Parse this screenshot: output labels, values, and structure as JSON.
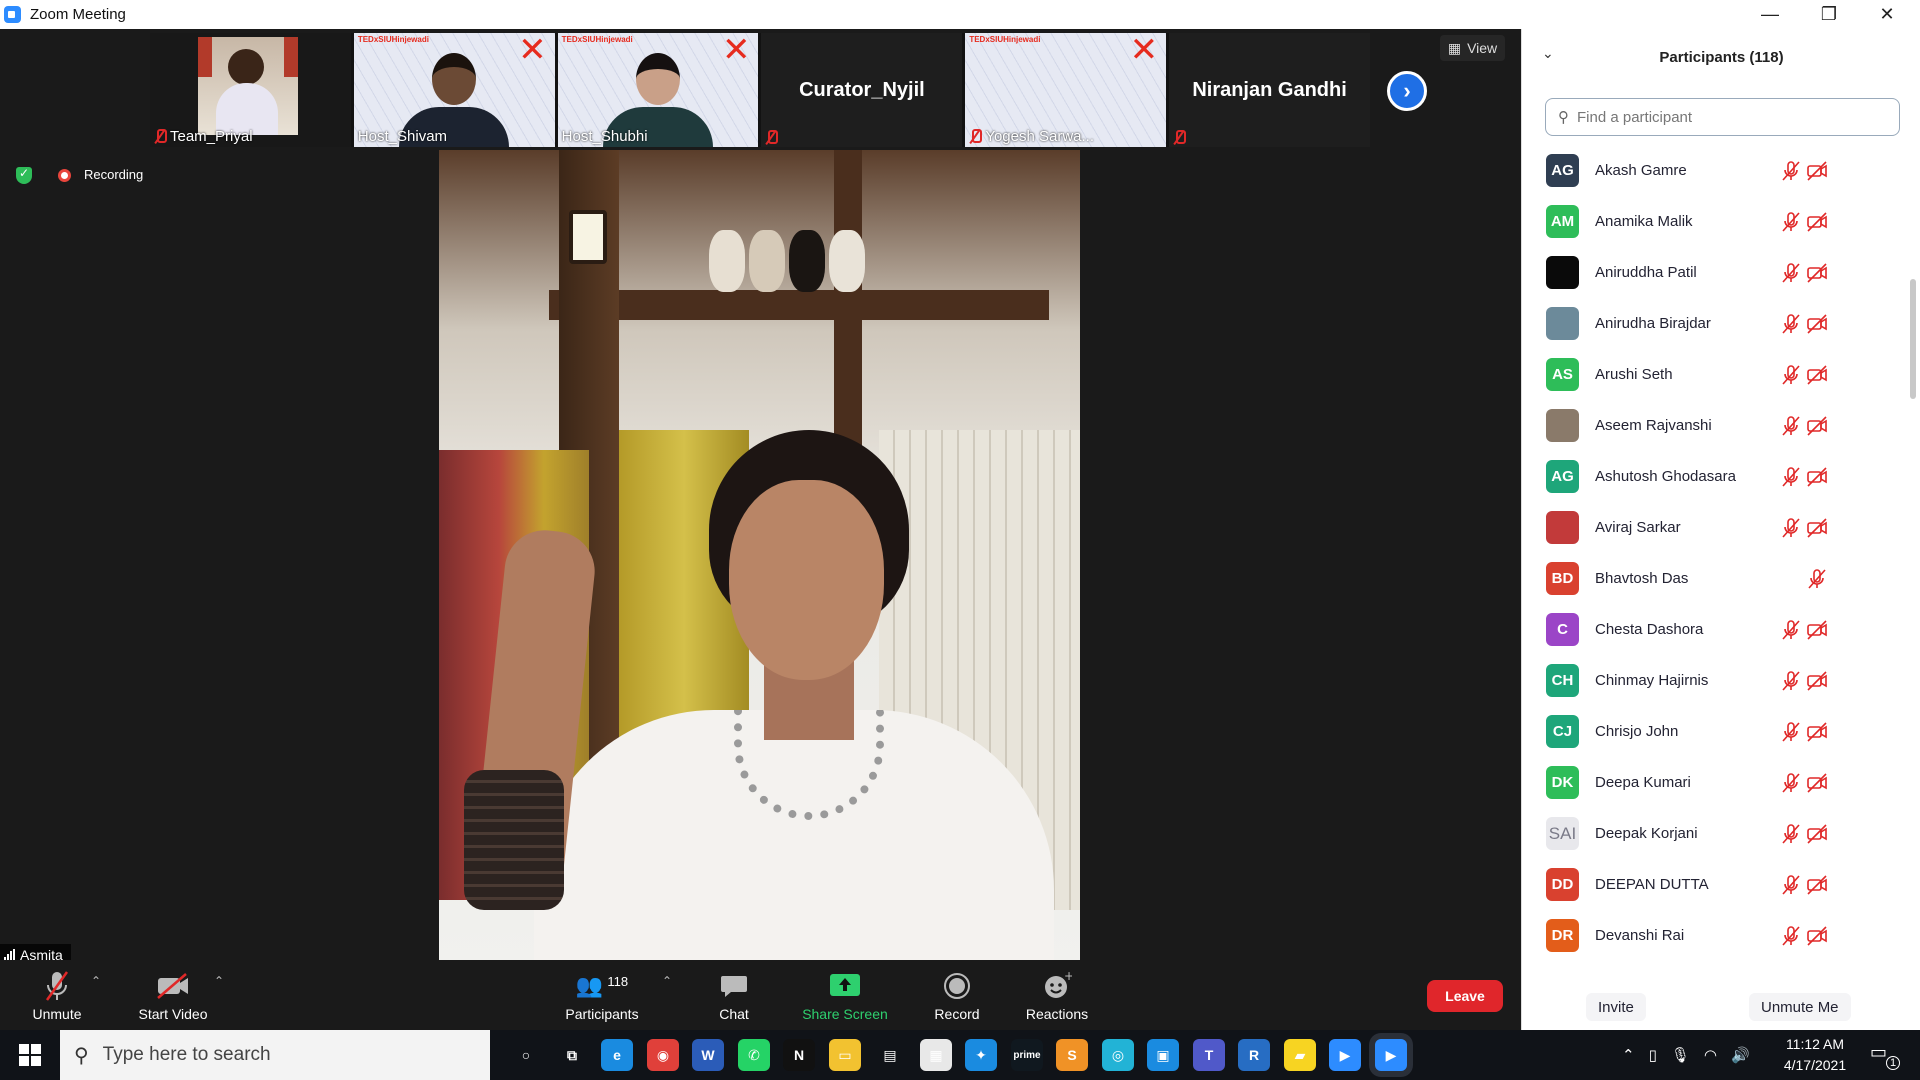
{
  "window": {
    "title": "Zoom Meeting",
    "minimize": "—",
    "restore": "❐",
    "close": "✕"
  },
  "thumbnails": [
    {
      "name": "Team_Priyal",
      "muted": true
    },
    {
      "name": "Host_Shivam",
      "muted": false
    },
    {
      "name": "Host_Shubhi",
      "muted": false
    },
    {
      "name": "Curator_Nyjil",
      "muted": true
    },
    {
      "name": "Yogesh Sarwa...",
      "muted": true
    },
    {
      "name": "Niranjan Gandhi",
      "muted": true
    }
  ],
  "tedx_label": "TEDxSIUHinjewadi",
  "view_label": "View",
  "recording_label": "Recording",
  "self_name": "Asmita",
  "toolbar": {
    "unmute": "Unmute",
    "start_video": "Start Video",
    "participants": "Participants",
    "participants_count": "118",
    "chat": "Chat",
    "share_screen": "Share Screen",
    "record": "Record",
    "reactions": "Reactions",
    "leave": "Leave"
  },
  "panel": {
    "title": "Participants (118)",
    "search_placeholder": "Find a participant",
    "invite": "Invite",
    "unmute_me": "Unmute Me"
  },
  "participants": [
    {
      "initials": "AG",
      "name": "Akash Gamre",
      "color": "#2f3e52",
      "video_icon": true
    },
    {
      "initials": "AM",
      "name": "Anamika Malik",
      "color": "#2ebd59",
      "video_icon": true
    },
    {
      "initials": "",
      "name": "Aniruddha Patil",
      "color": "#0a0a0a",
      "video_icon": true
    },
    {
      "initials": "",
      "name": "Anirudha Birajdar",
      "color": "#6c8a9a",
      "video_icon": true
    },
    {
      "initials": "AS",
      "name": "Arushi Seth",
      "color": "#2ebd59",
      "video_icon": true
    },
    {
      "initials": "",
      "name": "Aseem Rajvanshi",
      "color": "#8a7a6a",
      "video_icon": true
    },
    {
      "initials": "AG",
      "name": "Ashutosh Ghodasara",
      "color": "#1ea67a",
      "video_icon": true
    },
    {
      "initials": "",
      "name": "Aviraj Sarkar",
      "color": "#c23a3a",
      "video_icon": true
    },
    {
      "initials": "BD",
      "name": "Bhavtosh Das",
      "color": "#d9412f",
      "video_icon": false
    },
    {
      "initials": "C",
      "name": "Chesta Dashora",
      "color": "#9b45c7",
      "video_icon": true
    },
    {
      "initials": "CH",
      "name": "Chinmay Hajirnis",
      "color": "#1ea67a",
      "video_icon": true
    },
    {
      "initials": "CJ",
      "name": "Chrisjo John",
      "color": "#1ea67a",
      "video_icon": true
    },
    {
      "initials": "DK",
      "name": "Deepa Kumari",
      "color": "#2ebd59",
      "video_icon": true
    },
    {
      "initials": "SAI",
      "name": "Deepak Korjani",
      "color": "#e8e8ec",
      "video_icon": true
    },
    {
      "initials": "DD",
      "name": "DEEPAN DUTTA",
      "color": "#d9412f",
      "video_icon": true
    },
    {
      "initials": "DR",
      "name": "Devanshi Rai",
      "color": "#e35d1a",
      "video_icon": true
    }
  ],
  "taskbar": {
    "search_placeholder": "Type here to search",
    "time": "11:12 AM",
    "date": "4/17/2021",
    "notifications": "1",
    "apps": [
      {
        "icon": "cortana-icon",
        "glyph": "○",
        "color": "transparent"
      },
      {
        "icon": "task-view-icon",
        "glyph": "⧉",
        "color": "transparent"
      },
      {
        "icon": "edge-icon",
        "glyph": "e",
        "color": "#1a8be0"
      },
      {
        "icon": "chrome-icon",
        "glyph": "◉",
        "color": "#e0403a"
      },
      {
        "icon": "word-icon",
        "glyph": "W",
        "color": "#2b5cb8"
      },
      {
        "icon": "whatsapp-icon",
        "glyph": "✆",
        "color": "#25d366"
      },
      {
        "icon": "netflix-icon",
        "glyph": "N",
        "color": "#111111"
      },
      {
        "icon": "file-explorer-icon",
        "glyph": "▭",
        "color": "#f2c230"
      },
      {
        "icon": "documents-icon",
        "glyph": "▤",
        "color": "transparent"
      },
      {
        "icon": "store-icon",
        "glyph": "▦",
        "color": "#e8e8e8"
      },
      {
        "icon": "safari-icon",
        "glyph": "✦",
        "color": "#1a8be0"
      },
      {
        "icon": "prime-video-icon",
        "glyph": "prime",
        "color": "#10181f"
      },
      {
        "icon": "sublime-icon",
        "glyph": "S",
        "color": "#f09226"
      },
      {
        "icon": "instagram-icon",
        "glyph": "◎",
        "color": "#22b3d6"
      },
      {
        "icon": "photos-icon",
        "glyph": "▣",
        "color": "#1a8be0"
      },
      {
        "icon": "teams-icon",
        "glyph": "T",
        "color": "#5059c9"
      },
      {
        "icon": "r-icon",
        "glyph": "R",
        "color": "#276dc3"
      },
      {
        "icon": "sticky-notes-icon",
        "glyph": "▰",
        "color": "#f7d422"
      },
      {
        "icon": "zoom-icon",
        "glyph": "▶",
        "color": "#2d8cff"
      },
      {
        "icon": "zoom-active-icon",
        "glyph": "▶",
        "color": "#2d8cff"
      }
    ]
  }
}
